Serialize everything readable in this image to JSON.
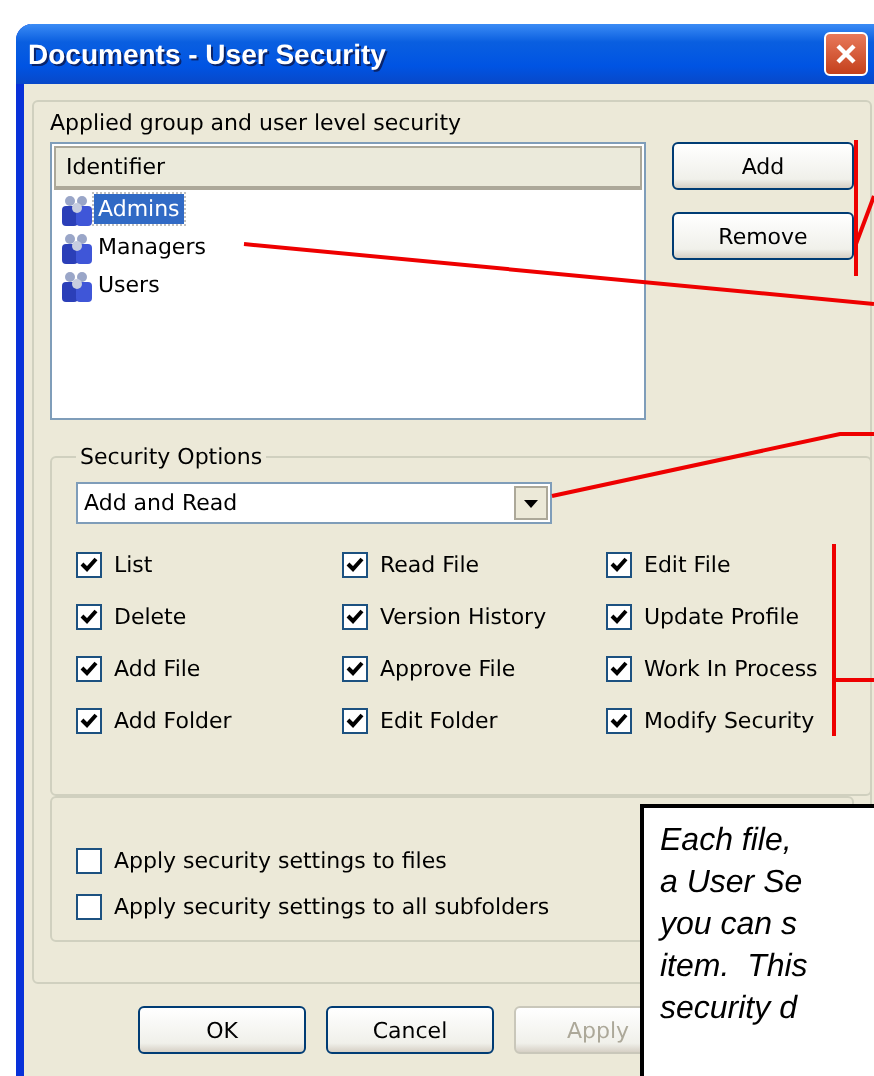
{
  "window": {
    "title": "Documents - User Security"
  },
  "security_list": {
    "label": "Applied group and user level security",
    "column": "Identifier",
    "items": [
      {
        "name": "Admins",
        "selected": true
      },
      {
        "name": "Managers",
        "selected": false
      },
      {
        "name": "Users",
        "selected": false
      }
    ]
  },
  "side_buttons": [
    "Add",
    "Remove"
  ],
  "security_options": {
    "label": "Security Options",
    "preset": "Add and Read",
    "permissions": [
      {
        "label": "List",
        "checked": true
      },
      {
        "label": "Read File",
        "checked": true
      },
      {
        "label": "Edit File",
        "checked": true
      },
      {
        "label": "Delete",
        "checked": true
      },
      {
        "label": "Version History",
        "checked": true
      },
      {
        "label": "Update Profile",
        "checked": true
      },
      {
        "label": "Add File",
        "checked": true
      },
      {
        "label": "Approve File",
        "checked": true
      },
      {
        "label": "Work In Process",
        "checked": true
      },
      {
        "label": "Add Folder",
        "checked": true
      },
      {
        "label": "Edit Folder",
        "checked": true
      },
      {
        "label": "Modify Security",
        "checked": true
      }
    ]
  },
  "apply_options": [
    {
      "label": "Apply security settings to files",
      "checked": false
    },
    {
      "label": "Apply security settings to all subfolders",
      "checked": false
    }
  ],
  "buttons": [
    {
      "label": "OK",
      "disabled": false
    },
    {
      "label": "Cancel",
      "disabled": false
    },
    {
      "label": "Apply",
      "disabled": true
    }
  ],
  "callout": {
    "lines": [
      "Each file,",
      "a User Se",
      "you can s",
      "item.  This",
      "security d"
    ]
  }
}
